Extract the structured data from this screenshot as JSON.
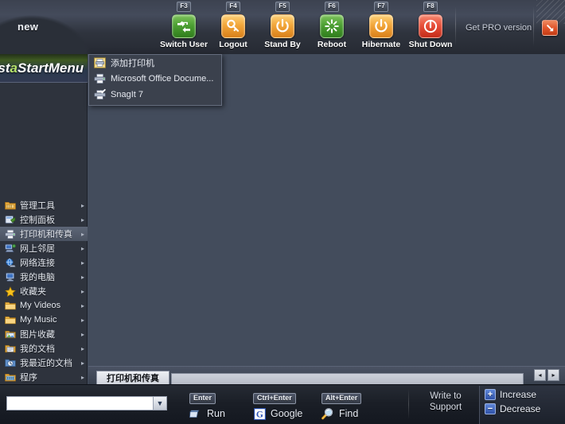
{
  "topbar": {
    "profile_label": "new",
    "get_pro_label": "Get PRO version",
    "collapse_icon": "arrow-down-right-icon",
    "power_buttons": [
      {
        "fkey": "F3",
        "label": "Switch User",
        "icon": "switch-user-icon",
        "color": "#4da033"
      },
      {
        "fkey": "F4",
        "label": "Logout",
        "icon": "key-icon",
        "color": "#f2a63a"
      },
      {
        "fkey": "F5",
        "label": "Stand By",
        "icon": "power-icon",
        "color": "#f2a63a"
      },
      {
        "fkey": "F6",
        "label": "Reboot",
        "icon": "reboot-icon",
        "color": "#4da033"
      },
      {
        "fkey": "F7",
        "label": "Hibernate",
        "icon": "power-icon",
        "color": "#f2a63a"
      },
      {
        "fkey": "F8",
        "label": "Shut Down",
        "icon": "shutdown-icon",
        "color": "#e8503a"
      }
    ]
  },
  "sidebar": {
    "logo_text_a": "Vist",
    "logo_text_b": "a",
    "logo_text_c": "StartMenu",
    "items": [
      {
        "label": "管理工具",
        "icon": "tools-folder-icon",
        "arrow": "▸",
        "selected": false
      },
      {
        "label": "控制面板",
        "icon": "control-panel-icon",
        "arrow": "▸",
        "selected": false
      },
      {
        "label": "打印机和传真",
        "icon": "printer-icon",
        "arrow": "▸",
        "selected": true
      },
      {
        "label": "网上邻居",
        "icon": "network-places-icon",
        "arrow": "▸",
        "selected": false
      },
      {
        "label": "网络连接",
        "icon": "network-globe-icon",
        "arrow": "▸",
        "selected": false
      },
      {
        "label": "我的电脑",
        "icon": "my-computer-icon",
        "arrow": "▸",
        "selected": false
      },
      {
        "label": "收藏夹",
        "icon": "star-icon",
        "arrow": "▸",
        "selected": false
      },
      {
        "label": "My Videos",
        "icon": "folder-icon",
        "arrow": "▸",
        "selected": false
      },
      {
        "label": "My Music",
        "icon": "folder-icon",
        "arrow": "▸",
        "selected": false
      },
      {
        "label": "图片收藏",
        "icon": "pictures-folder-icon",
        "arrow": "▸",
        "selected": false
      },
      {
        "label": "我的文档",
        "icon": "documents-folder-icon",
        "arrow": "▸",
        "selected": false
      },
      {
        "label": "我最近的文档",
        "icon": "recent-documents-icon",
        "arrow": "▸",
        "selected": false
      },
      {
        "label": "程序",
        "icon": "programs-folder-icon",
        "arrow": "▸",
        "selected": false
      }
    ]
  },
  "submenu": {
    "items": [
      {
        "label": "添加打印机",
        "icon": "add-printer-icon"
      },
      {
        "label": "Microsoft Office Docume...",
        "icon": "printer-icon"
      },
      {
        "label": "SnagIt 7",
        "icon": "snagit-printer-icon"
      }
    ]
  },
  "tabstrip": {
    "active_tab": "打印机和传真",
    "scroll_left_icon": "◂",
    "scroll_right_icon": "▸"
  },
  "bottombar": {
    "search": {
      "value": "",
      "placeholder": ""
    },
    "search_dropdown_icon": "chevron-down-icon",
    "shortcuts": [
      {
        "key": "Enter",
        "label": "Run",
        "icon": "run-icon"
      },
      {
        "key": "Ctrl+Enter",
        "label": "Google",
        "icon": "google-icon"
      },
      {
        "key": "Alt+Enter",
        "label": "Find",
        "icon": "magnifier-icon"
      }
    ],
    "write_to_support_line1": "Write to",
    "write_to_support_line2": "Support",
    "zoom": {
      "increase_label": "Increase",
      "decrease_label": "Decrease",
      "increase_sign": "+",
      "decrease_sign": "−"
    }
  },
  "colors": {
    "content_bg": "#434c5c",
    "sidebar_bg": "#2e333d",
    "submenu_bg": "#3b414d",
    "accent_green": "#4da033",
    "accent_orange": "#f2a63a",
    "accent_red": "#e8503a",
    "accent_blue": "#2f52a8"
  }
}
